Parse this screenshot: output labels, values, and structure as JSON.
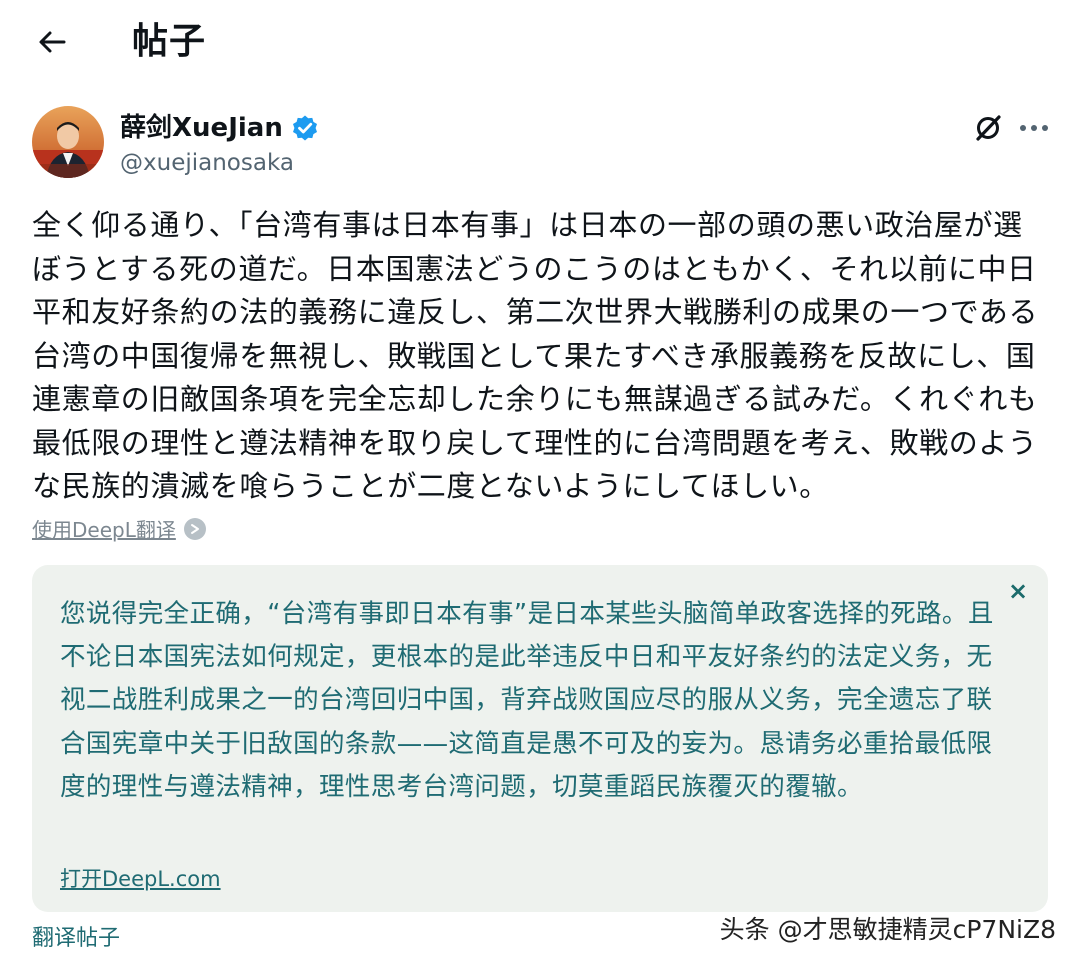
{
  "header": {
    "title": "帖子",
    "back_icon": "arrow-left-icon"
  },
  "author": {
    "name": "薛剑XueJian",
    "handle": "@xuejianosaka",
    "verified_icon": "verified-badge-icon",
    "verified_color": "#1d9bf0"
  },
  "post": {
    "text": "全く仰る通り、「台湾有事は日本有事」は日本の一部の頭の悪い政治屋が選ぼうとする死の道だ。日本国憲法どうのこうのはともかく、それ以前に中日平和友好条約の法的義務に違反し、第二次世界大戦勝利の成果の一つである台湾の中国復帰を無視し、敗戦国として果たすべき承服義務を反故にし、国連憲章の旧敵国条項を完全忘却した余りにも無謀過ぎる試みだ。くれぐれも最低限の理性と遵法精神を取り戻して理性的に台湾問題を考え、敗戦のような民族的潰滅を喰らうことが二度とないようにしてほしい。"
  },
  "translation": {
    "translated_with_label": "使用DeepL翻译",
    "text": "您说得完全正确，“台湾有事即日本有事”是日本某些头脑简单政客选择的死路。且不论日本国宪法如何规定，更根本的是此举违反中日和平友好条约的法定义务，无视二战胜利成果之一的台湾回归中国，背弃战败国应尽的服从义务，完全遗忘了联合国宪章中关于旧敌国的条款——这简直是愚不可及的妄为。恳请务必重拾最低限度的理性与遵法精神，理性思考台湾问题，切莫重蹈民族覆灭的覆辙。",
    "open_link": "打开DeepL.com",
    "close_label": "×",
    "box_color": "#eef2ee",
    "text_color": "#1f6b73"
  },
  "footer": {
    "translate_post": "翻译帖子",
    "watermark": "头条 @才思敏捷精灵cP7NiZ8"
  },
  "icons": {
    "grok": "grok-icon",
    "more": "more-horizontal-icon",
    "deepl": "deepl-icon"
  }
}
